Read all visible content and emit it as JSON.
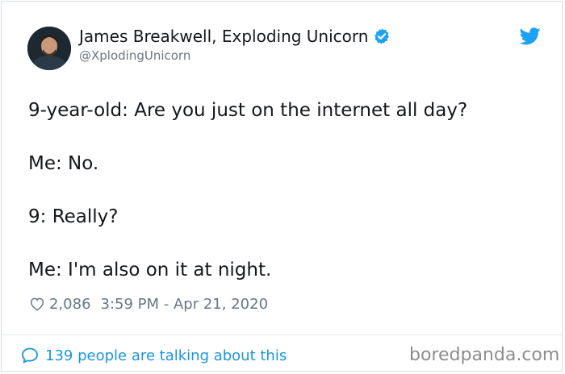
{
  "author": {
    "name": "James Breakwell, Exploding Unicorn",
    "handle": "@XplodingUnicorn",
    "verified": true,
    "avatar_icon": "avatar"
  },
  "tweet": {
    "lines": [
      "9-year-old: Are you just on the internet all day?",
      "Me: No.",
      "9: Really?",
      "Me: I'm also on it at night."
    ]
  },
  "meta": {
    "likes": "2,086",
    "timestamp": "3:59 PM - Apr 21, 2020"
  },
  "footer": {
    "talking_text": "139 people are talking about this",
    "watermark": "boredpanda.com"
  },
  "colors": {
    "twitter_blue": "#1da1f2",
    "link_blue": "#1b95e0",
    "text": "#14171a",
    "muted": "#657786"
  }
}
